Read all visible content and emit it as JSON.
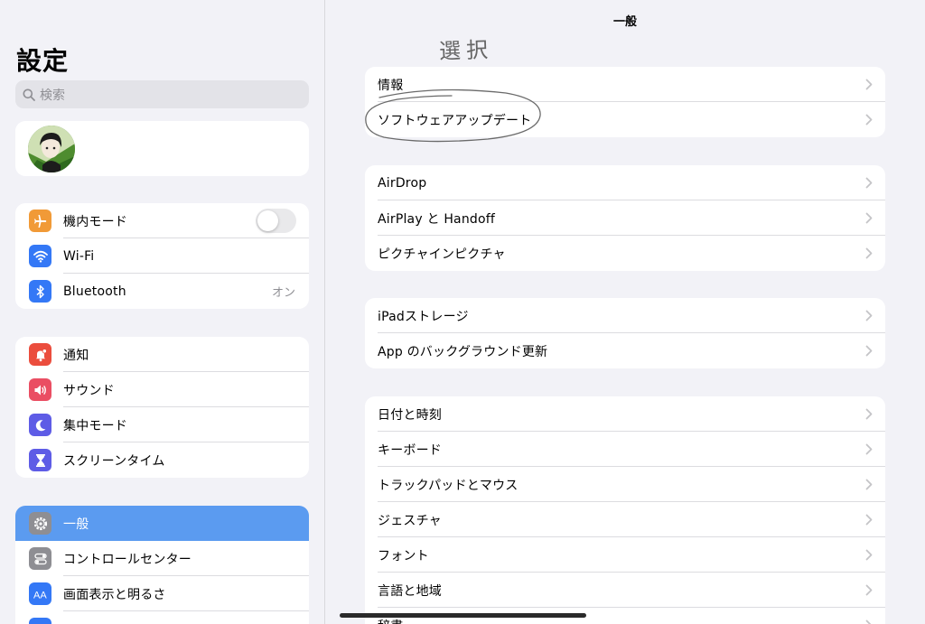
{
  "sidebar": {
    "title": "設定",
    "search_placeholder": "検索",
    "group1": [
      {
        "label": "機内モード",
        "icon": "airplane-icon",
        "color": "#f19a37",
        "toggle": false
      },
      {
        "label": "Wi-Fi",
        "icon": "wifi-icon",
        "color": "#3478f6"
      },
      {
        "label": "Bluetooth",
        "icon": "bluetooth-icon",
        "color": "#3478f6",
        "value": "オン"
      }
    ],
    "group2": [
      {
        "label": "通知",
        "icon": "notification-icon",
        "color": "#eb4d3d"
      },
      {
        "label": "サウンド",
        "icon": "sound-icon",
        "color": "#ea4e63"
      },
      {
        "label": "集中モード",
        "icon": "moon-icon",
        "color": "#5e5ce6"
      },
      {
        "label": "スクリーンタイム",
        "icon": "hourglass-icon",
        "color": "#5e5ce6"
      }
    ],
    "group3": [
      {
        "label": "一般",
        "icon": "gear-icon",
        "color": "#8e8e93",
        "selected": true
      },
      {
        "label": "コントロールセンター",
        "icon": "control-center-icon",
        "color": "#8e8e93"
      },
      {
        "label": "画面表示と明るさ",
        "icon": "display-icon",
        "color": "#3478f6"
      }
    ]
  },
  "main": {
    "title": "一般",
    "annotation": "選択",
    "group1": [
      "情報",
      "ソフトウェアアップデート"
    ],
    "group2": [
      "AirDrop",
      "AirPlay と Handoff",
      "ピクチャインピクチャ"
    ],
    "group3": [
      "iPadストレージ",
      "App のバックグラウンド更新"
    ],
    "group4": [
      "日付と時刻",
      "キーボード",
      "トラックパッドとマウス",
      "ジェスチャ",
      "フォント",
      "言語と地域",
      "辞書"
    ]
  }
}
